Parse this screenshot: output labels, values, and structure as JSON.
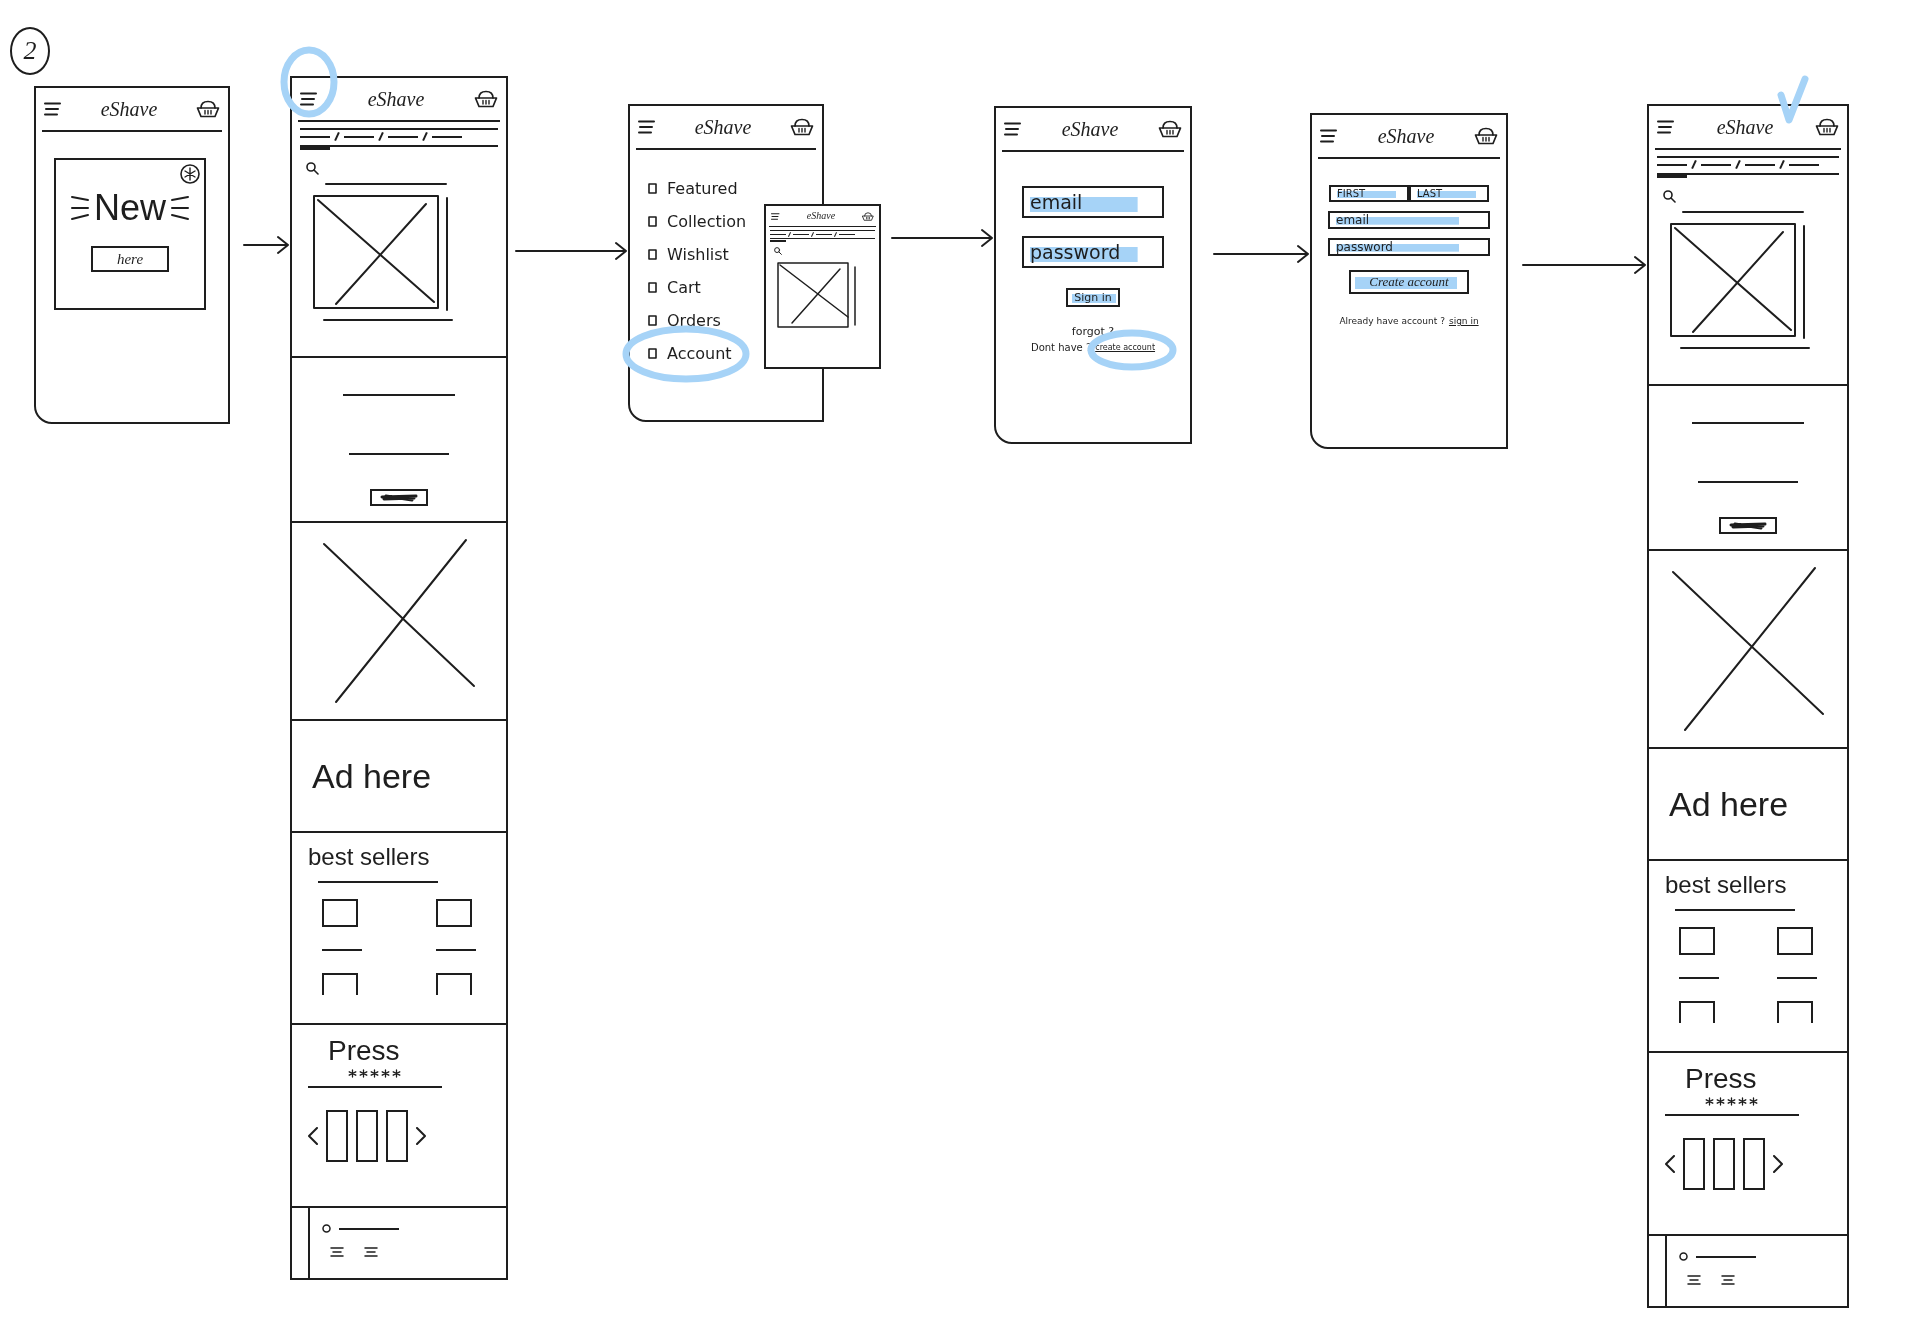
{
  "sketch_number": "2",
  "screens": [
    {
      "kind": "popup",
      "header": {
        "logo": "eShave",
        "menu_circled": false
      },
      "popup": {
        "title": "New",
        "button": "here"
      }
    },
    {
      "kind": "home",
      "header": {
        "logo": "eShave",
        "menu_circled": true
      },
      "approved": false,
      "nav_tabs": [
        {
          "selected": true
        },
        {
          "selected": false
        },
        {
          "selected": false
        },
        {
          "selected": false
        }
      ],
      "ad": "Ad here",
      "best_sellers": "best sellers",
      "press": {
        "title": "Press",
        "stars": 5
      }
    },
    {
      "kind": "menu",
      "header": {
        "logo": "eShave",
        "menu_circled": false
      },
      "menu_items": [
        {
          "label": "Featured",
          "selected": false
        },
        {
          "label": "Collection",
          "selected": false
        },
        {
          "label": "Wishlist",
          "selected": false
        },
        {
          "label": "Cart",
          "selected": false
        },
        {
          "label": "Orders",
          "selected": false
        },
        {
          "label": "Account",
          "selected": true
        }
      ],
      "preview": {
        "logo": "eShave",
        "nav_tabs": [
          {
            "selected": true
          },
          {
            "selected": false
          },
          {
            "selected": false
          },
          {
            "selected": false
          }
        ]
      }
    },
    {
      "kind": "sign_in",
      "header": {
        "logo": "eShave",
        "menu_circled": false
      },
      "fields": [
        {
          "placeholder": "email"
        },
        {
          "placeholder": "password"
        }
      ],
      "button": "Sign in",
      "forgot": "forgot ?",
      "signup_prompt": "Dont have ?",
      "signup_link": {
        "label": "create account",
        "circled": true
      }
    },
    {
      "kind": "sign_up",
      "header": {
        "logo": "eShave",
        "menu_circled": false
      },
      "name_fields": [
        {
          "placeholder": "FIRST"
        },
        {
          "placeholder": "LAST"
        }
      ],
      "fields": [
        {
          "placeholder": "email"
        },
        {
          "placeholder": "password"
        }
      ],
      "button": "Create account",
      "signin_prompt": "Already have account ?",
      "signin_link": "sign in"
    },
    {
      "kind": "home",
      "header": {
        "logo": "eShave",
        "menu_circled": false
      },
      "approved": true,
      "nav_tabs": [
        {
          "selected": true
        },
        {
          "selected": false
        },
        {
          "selected": false
        },
        {
          "selected": false
        }
      ],
      "ad": "Ad here",
      "best_sellers": "best sellers",
      "press": {
        "title": "Press",
        "stars": 5
      }
    }
  ]
}
